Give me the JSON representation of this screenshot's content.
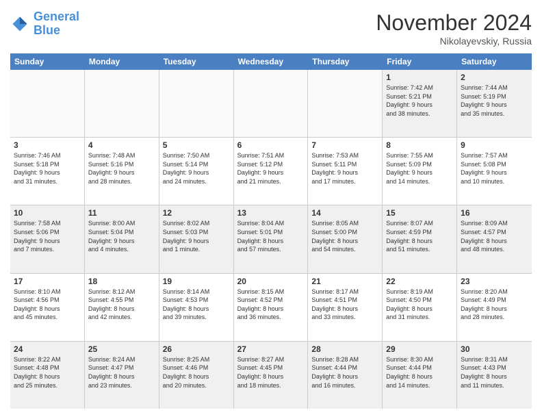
{
  "logo": {
    "line1": "General",
    "line2": "Blue"
  },
  "title": "November 2024",
  "location": "Nikolayevskiy, Russia",
  "header": {
    "days": [
      "Sunday",
      "Monday",
      "Tuesday",
      "Wednesday",
      "Thursday",
      "Friday",
      "Saturday"
    ]
  },
  "weeks": [
    [
      {
        "day": "",
        "info": ""
      },
      {
        "day": "",
        "info": ""
      },
      {
        "day": "",
        "info": ""
      },
      {
        "day": "",
        "info": ""
      },
      {
        "day": "",
        "info": ""
      },
      {
        "day": "1",
        "info": "Sunrise: 7:42 AM\nSunset: 5:21 PM\nDaylight: 9 hours\nand 38 minutes."
      },
      {
        "day": "2",
        "info": "Sunrise: 7:44 AM\nSunset: 5:19 PM\nDaylight: 9 hours\nand 35 minutes."
      }
    ],
    [
      {
        "day": "3",
        "info": "Sunrise: 7:46 AM\nSunset: 5:18 PM\nDaylight: 9 hours\nand 31 minutes."
      },
      {
        "day": "4",
        "info": "Sunrise: 7:48 AM\nSunset: 5:16 PM\nDaylight: 9 hours\nand 28 minutes."
      },
      {
        "day": "5",
        "info": "Sunrise: 7:50 AM\nSunset: 5:14 PM\nDaylight: 9 hours\nand 24 minutes."
      },
      {
        "day": "6",
        "info": "Sunrise: 7:51 AM\nSunset: 5:12 PM\nDaylight: 9 hours\nand 21 minutes."
      },
      {
        "day": "7",
        "info": "Sunrise: 7:53 AM\nSunset: 5:11 PM\nDaylight: 9 hours\nand 17 minutes."
      },
      {
        "day": "8",
        "info": "Sunrise: 7:55 AM\nSunset: 5:09 PM\nDaylight: 9 hours\nand 14 minutes."
      },
      {
        "day": "9",
        "info": "Sunrise: 7:57 AM\nSunset: 5:08 PM\nDaylight: 9 hours\nand 10 minutes."
      }
    ],
    [
      {
        "day": "10",
        "info": "Sunrise: 7:58 AM\nSunset: 5:06 PM\nDaylight: 9 hours\nand 7 minutes."
      },
      {
        "day": "11",
        "info": "Sunrise: 8:00 AM\nSunset: 5:04 PM\nDaylight: 9 hours\nand 4 minutes."
      },
      {
        "day": "12",
        "info": "Sunrise: 8:02 AM\nSunset: 5:03 PM\nDaylight: 9 hours\nand 1 minute."
      },
      {
        "day": "13",
        "info": "Sunrise: 8:04 AM\nSunset: 5:01 PM\nDaylight: 8 hours\nand 57 minutes."
      },
      {
        "day": "14",
        "info": "Sunrise: 8:05 AM\nSunset: 5:00 PM\nDaylight: 8 hours\nand 54 minutes."
      },
      {
        "day": "15",
        "info": "Sunrise: 8:07 AM\nSunset: 4:59 PM\nDaylight: 8 hours\nand 51 minutes."
      },
      {
        "day": "16",
        "info": "Sunrise: 8:09 AM\nSunset: 4:57 PM\nDaylight: 8 hours\nand 48 minutes."
      }
    ],
    [
      {
        "day": "17",
        "info": "Sunrise: 8:10 AM\nSunset: 4:56 PM\nDaylight: 8 hours\nand 45 minutes."
      },
      {
        "day": "18",
        "info": "Sunrise: 8:12 AM\nSunset: 4:55 PM\nDaylight: 8 hours\nand 42 minutes."
      },
      {
        "day": "19",
        "info": "Sunrise: 8:14 AM\nSunset: 4:53 PM\nDaylight: 8 hours\nand 39 minutes."
      },
      {
        "day": "20",
        "info": "Sunrise: 8:15 AM\nSunset: 4:52 PM\nDaylight: 8 hours\nand 36 minutes."
      },
      {
        "day": "21",
        "info": "Sunrise: 8:17 AM\nSunset: 4:51 PM\nDaylight: 8 hours\nand 33 minutes."
      },
      {
        "day": "22",
        "info": "Sunrise: 8:19 AM\nSunset: 4:50 PM\nDaylight: 8 hours\nand 31 minutes."
      },
      {
        "day": "23",
        "info": "Sunrise: 8:20 AM\nSunset: 4:49 PM\nDaylight: 8 hours\nand 28 minutes."
      }
    ],
    [
      {
        "day": "24",
        "info": "Sunrise: 8:22 AM\nSunset: 4:48 PM\nDaylight: 8 hours\nand 25 minutes."
      },
      {
        "day": "25",
        "info": "Sunrise: 8:24 AM\nSunset: 4:47 PM\nDaylight: 8 hours\nand 23 minutes."
      },
      {
        "day": "26",
        "info": "Sunrise: 8:25 AM\nSunset: 4:46 PM\nDaylight: 8 hours\nand 20 minutes."
      },
      {
        "day": "27",
        "info": "Sunrise: 8:27 AM\nSunset: 4:45 PM\nDaylight: 8 hours\nand 18 minutes."
      },
      {
        "day": "28",
        "info": "Sunrise: 8:28 AM\nSunset: 4:44 PM\nDaylight: 8 hours\nand 16 minutes."
      },
      {
        "day": "29",
        "info": "Sunrise: 8:30 AM\nSunset: 4:44 PM\nDaylight: 8 hours\nand 14 minutes."
      },
      {
        "day": "30",
        "info": "Sunrise: 8:31 AM\nSunset: 4:43 PM\nDaylight: 8 hours\nand 11 minutes."
      }
    ]
  ]
}
